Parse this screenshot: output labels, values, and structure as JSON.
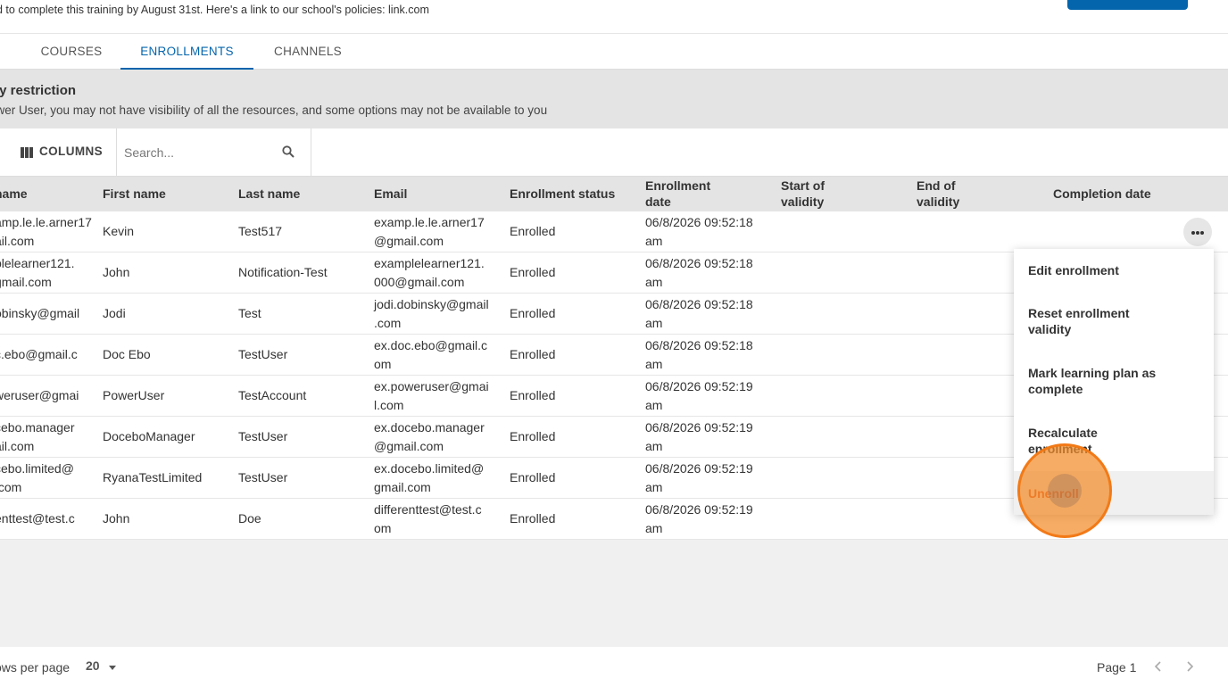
{
  "banner": {
    "description": "d to complete this training by August 31st.  Here's a link to our school's policies: link.com"
  },
  "tabs": [
    {
      "label": "COURSES"
    },
    {
      "label": "ENROLLMENTS",
      "active": true
    },
    {
      "label": "CHANNELS"
    }
  ],
  "notice": {
    "title": "ity restriction",
    "text": "ower User, you may not have visibility of all the resources, and some options may not be available to you"
  },
  "toolbar": {
    "columns_label": "COLUMNS",
    "search_placeholder": "Search..."
  },
  "table": {
    "headers": {
      "username": "name",
      "first_name": "First name",
      "last_name": "Last name",
      "email": "Email",
      "enrollment_status": "Enrollment status",
      "enrollment_date": [
        "Enrollment",
        "date"
      ],
      "start_validity": [
        "Start of",
        "validity"
      ],
      "end_validity": [
        "End of",
        "validity"
      ],
      "completion_date": "Completion date"
    },
    "rows": [
      {
        "username": [
          "amp.le.le.arner17",
          "ail.com"
        ],
        "first": "Kevin",
        "last": "Test517",
        "email": [
          "examp.le.le.arner17",
          "@gmail.com"
        ],
        "status": "Enrolled",
        "date": [
          "06/8/2026 09:52:18",
          "am"
        ]
      },
      {
        "username": [
          "plelearner121.",
          "gmail.com"
        ],
        "first": "John",
        "last": "Notification-Test",
        "email": [
          "examplelearner121.",
          "000@gmail.com"
        ],
        "status": "Enrolled",
        "date": [
          "06/8/2026 09:52:18",
          "am"
        ]
      },
      {
        "username": [
          "obinsky@gmail",
          ""
        ],
        "first": "Jodi",
        "last": "Test",
        "email": [
          "jodi.dobinsky@gmail",
          ".com"
        ],
        "status": "Enrolled",
        "date": [
          "06/8/2026 09:52:18",
          "am"
        ]
      },
      {
        "username": [
          "c.ebo@gmail.c",
          ""
        ],
        "first": "Doc Ebo",
        "last": "TestUser",
        "email": [
          "ex.doc.ebo@gmail.c",
          "om"
        ],
        "status": "Enrolled",
        "date": [
          "06/8/2026 09:52:18",
          "am"
        ]
      },
      {
        "username": [
          "weruser@gmai",
          ""
        ],
        "first": "PowerUser",
        "last": "TestAccount",
        "email": [
          "ex.poweruser@gmai",
          "l.com"
        ],
        "status": "Enrolled",
        "date": [
          "06/8/2026 09:52:19",
          "am"
        ]
      },
      {
        "username": [
          "cebo.manager",
          "ail.com"
        ],
        "first": "DoceboManager",
        "last": "TestUser",
        "email": [
          "ex.docebo.manager",
          "@gmail.com"
        ],
        "status": "Enrolled",
        "date": [
          "06/8/2026 09:52:19",
          "am"
        ]
      },
      {
        "username": [
          "cebo.limited@",
          ".com"
        ],
        "first": "RyanaTestLimited",
        "last": "TestUser",
        "email": [
          "ex.docebo.limited@",
          "gmail.com"
        ],
        "status": "Enrolled",
        "date": [
          "06/8/2026 09:52:19",
          "am"
        ]
      },
      {
        "username": [
          "enttest@test.c",
          ""
        ],
        "first": "John",
        "last": "Doe",
        "email": [
          "differenttest@test.c",
          "om"
        ],
        "status": "Enrolled",
        "date": [
          "06/8/2026 09:52:19",
          "am"
        ]
      }
    ]
  },
  "context_menu": {
    "items": [
      {
        "label": "Edit enrollment"
      },
      {
        "label": [
          "Reset enrollment",
          "validity"
        ]
      },
      {
        "label": [
          "Mark learning plan as",
          "complete"
        ]
      },
      {
        "label": [
          "Recalculate",
          "enrollment"
        ]
      },
      {
        "label": "Unenroll",
        "danger": true
      }
    ]
  },
  "footer": {
    "rows_per_page_label": "ows per page",
    "rows_per_page_value": "20",
    "page_label": "Page 1"
  },
  "colors": {
    "accent": "#0465ac",
    "danger": "#e0502a",
    "header_bg": "#e4e4e4",
    "click_marker": "#f28c28"
  },
  "icons": [
    "columns-icon",
    "search-icon",
    "more-horizontal-icon",
    "chevron-down-icon",
    "chevron-left-icon",
    "chevron-right-icon"
  ]
}
